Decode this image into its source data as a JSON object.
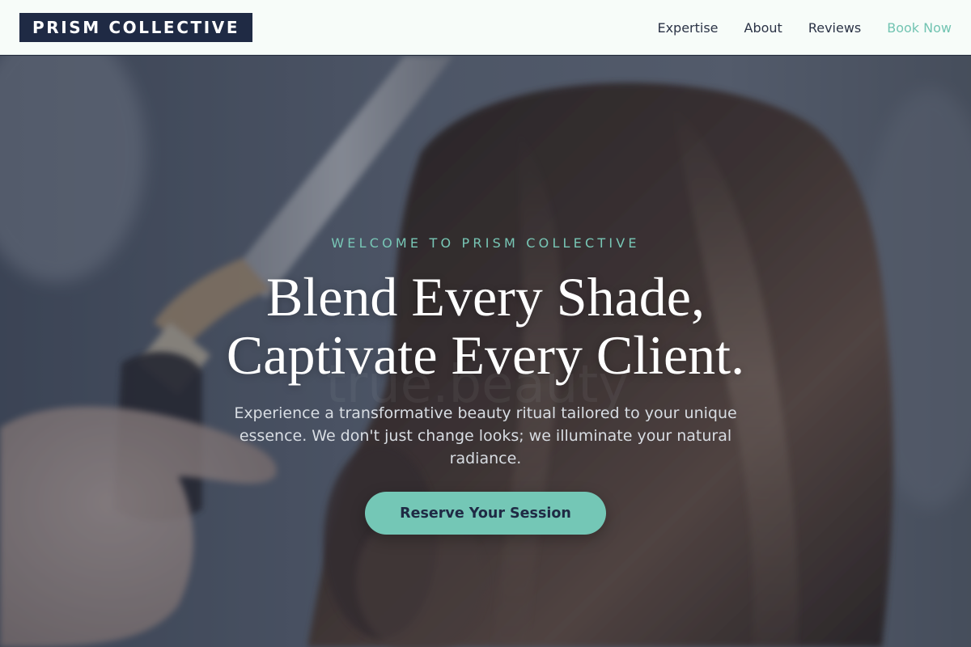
{
  "header": {
    "brand": "PRISM COLLECTIVE",
    "nav": [
      {
        "label": "Expertise"
      },
      {
        "label": "About"
      },
      {
        "label": "Reviews"
      },
      {
        "label": "Book Now"
      }
    ]
  },
  "hero": {
    "eyebrow": "WELCOME TO PRISM COLLECTIVE",
    "headline_line1": "Blend Every Shade,",
    "headline_line2": "Captivate Every Client.",
    "subtext": "Experience a transformative beauty ritual tailored to your unique essence. We don't just change looks; we illuminate your natural radiance.",
    "cta_label": "Reserve Your Session",
    "background_image_note": "hair-styling-photo"
  },
  "colors": {
    "brand_navy": "#1f2a44",
    "accent_teal": "#74c7b6",
    "header_bg": "#f7fcf9",
    "nav_text": "#2b3346"
  }
}
